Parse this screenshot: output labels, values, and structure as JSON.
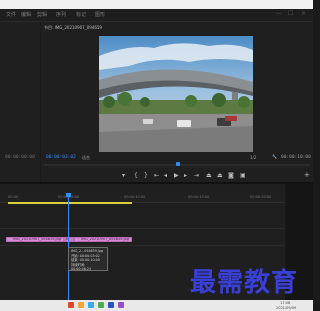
{
  "menu": {
    "items": [
      "文件",
      "编辑",
      "剪辑",
      "序列",
      "标记",
      "图形",
      "视图",
      "窗口",
      "帮助"
    ],
    "window_controls": [
      "—",
      "☐",
      "✕"
    ]
  },
  "program_monitor": {
    "title": "节目: IMG_20210907_094659",
    "timecode_left": "00:00:03:02",
    "fit_label": "适合",
    "scale_label": "1/2",
    "timecode_right": "00:00:10:00"
  },
  "source_panel": {
    "timecode": "00:00:00:00"
  },
  "timeline": {
    "ruler_labels": [
      "00:00",
      "00:00:05:00",
      "00:00:10:00",
      "00:00:15:00",
      "00:00:20:00"
    ],
    "clip1_label": "IMG_20210907_094659.jpg",
    "clip2_label": "IMG_20210907_094659.jpg",
    "fx_badge": "fx"
  },
  "tooltip": {
    "lines": [
      "IMG_2...094659.jpg",
      "开始: 00:00:03:02",
      "结束: 00:00:10:00",
      "持续时间: 00:00:06:23"
    ]
  },
  "taskbar": {
    "time": "17:08",
    "date": "2021/09/09"
  },
  "watermark": "最需教育",
  "colors": {
    "accent": "#2f8cff",
    "clip": "#d98ad6",
    "watermark": "#3a3fd8"
  }
}
